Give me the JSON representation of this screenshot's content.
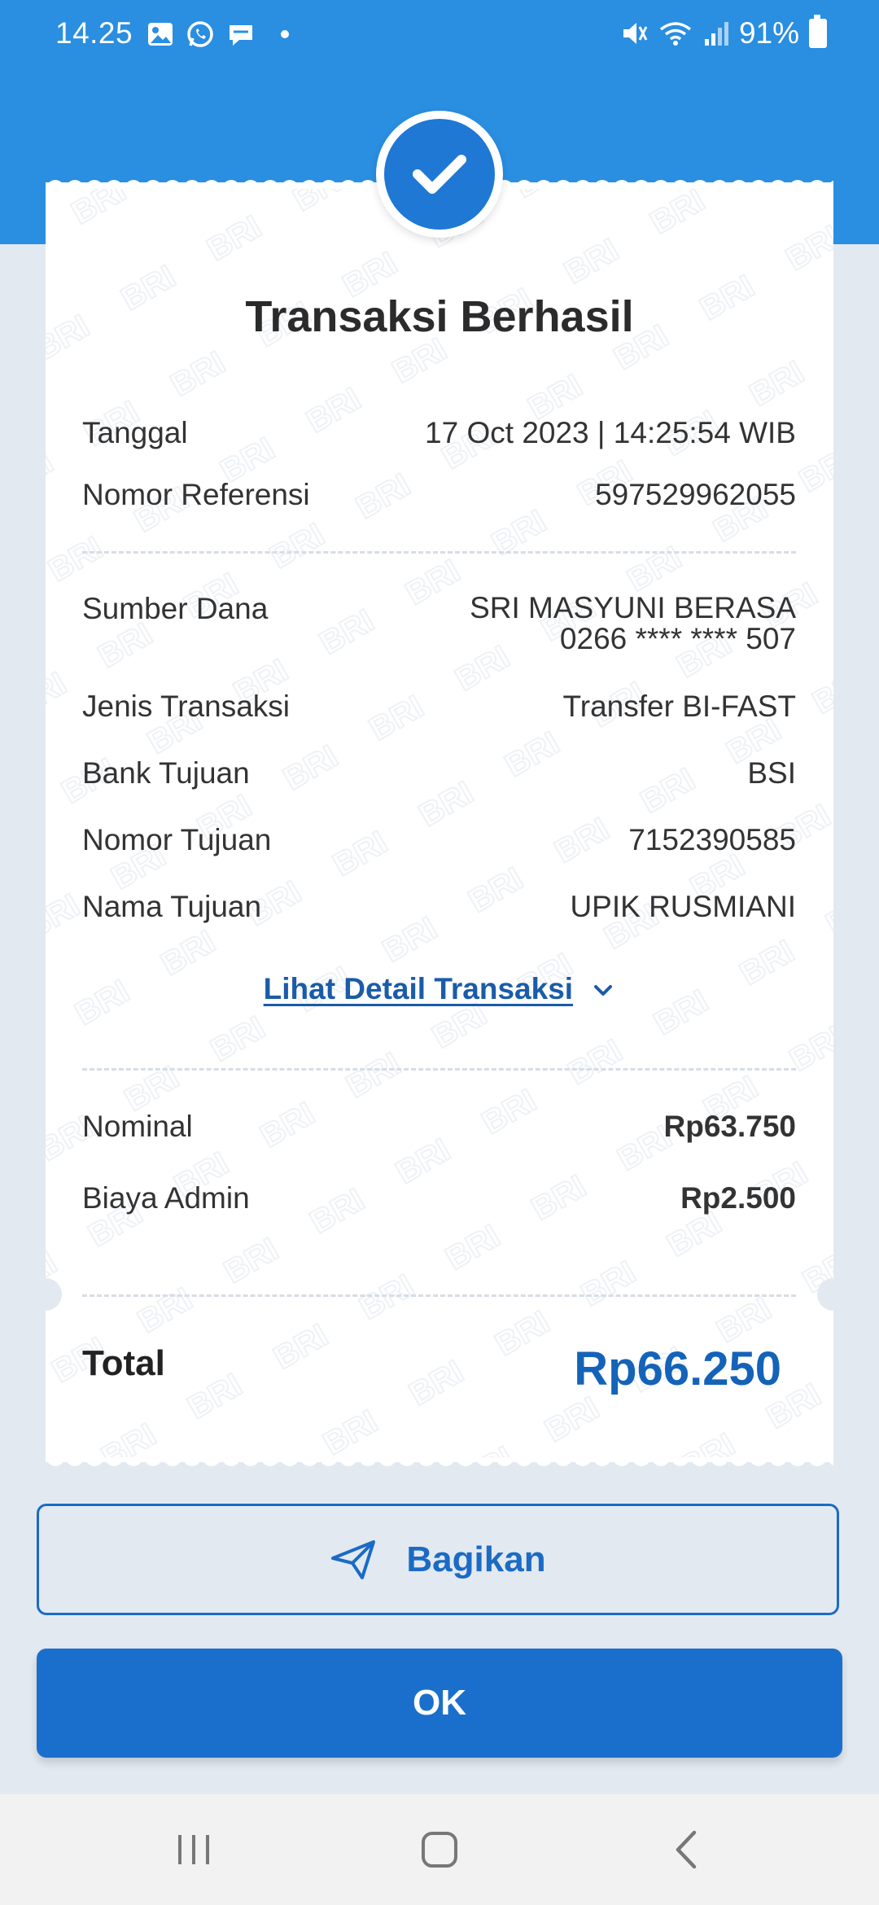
{
  "status_bar": {
    "time": "14.25",
    "battery": "91%",
    "icons_left": [
      "gallery-icon",
      "whatsapp-icon",
      "chat-icon",
      "dot-icon"
    ],
    "icons_right": [
      "mute-icon",
      "wifi-icon",
      "signal-icon",
      "battery-icon"
    ]
  },
  "receipt": {
    "title": "Transaksi Berhasil",
    "watermark": "BRI",
    "tanggal_label": "Tanggal",
    "tanggal_value": "17 Oct 2023 | 14:25:54 WIB",
    "referensi_label": "Nomor Referensi",
    "referensi_value": "597529962055",
    "sumber_label": "Sumber Dana",
    "sumber_name": "SRI MASYUNI BERASA",
    "sumber_account": "0266 **** **** 507",
    "jenis_label": "Jenis Transaksi",
    "jenis_value": "Transfer BI-FAST",
    "bank_label": "Bank Tujuan",
    "bank_value": "BSI",
    "nomor_tujuan_label": "Nomor Tujuan",
    "nomor_tujuan_value": "7152390585",
    "nama_tujuan_label": "Nama Tujuan",
    "nama_tujuan_value": "UPIK RUSMIANI",
    "detail_link": "Lihat Detail Transaksi",
    "nominal_label": "Nominal",
    "nominal_value": "Rp63.750",
    "admin_label": "Biaya Admin",
    "admin_value": "Rp2.500",
    "total_label": "Total",
    "total_value": "Rp66.250"
  },
  "actions": {
    "share_label": "Bagikan",
    "ok_label": "OK"
  },
  "colors": {
    "header": "#2a8ee1",
    "primary": "#1a6fcc",
    "total": "#1463b8",
    "page_bg": "#e3e9f1"
  }
}
